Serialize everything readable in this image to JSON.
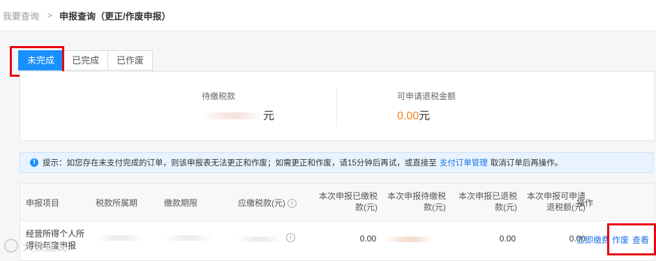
{
  "breadcrumb": {
    "parent": "我要查询",
    "separator": ">",
    "current": "申报查询（更正/作废申报）"
  },
  "tabs": [
    {
      "label": "未完成",
      "active": true
    },
    {
      "label": "已完成",
      "active": false
    },
    {
      "label": "已作废",
      "active": false
    }
  ],
  "summary": {
    "pending_label": "待缴税款",
    "pending_unit": "元",
    "refund_label": "可申请退税金额",
    "refund_value": "0.00",
    "refund_unit": "元"
  },
  "notice": {
    "icon": "info-icon",
    "text_before": "提示：如您存在未支付完成的订单，则该申报表无法更正和作废；如需更正和作废，请15分钟后再试，或直接至",
    "link": "支付订单管理",
    "text_after": "取消订单后再操作。"
  },
  "table": {
    "headers": {
      "item": "申报项目",
      "period": "税款所属期",
      "deadline": "缴款期限",
      "tax_payable": "应缴税款(元)",
      "paid_l1": "本次申报已缴税",
      "paid_l2": "款(元)",
      "pending_l1": "本次申报待缴税",
      "pending_l2": "款(元)",
      "refunded_l1": "本次申报已退税",
      "refunded_l2": "款(元)",
      "refundable_l1": "本次申报可申请",
      "refundable_l2": "退税额(元)",
      "ops": "操作"
    },
    "rows": [
      {
        "item_l1": "经营所得个人所",
        "item_l2": "得税年度申报",
        "paid": "0.00",
        "refunded": "0.00",
        "refundable": "0.00",
        "actions": {
          "pay": "立即缴费",
          "void": "作废",
          "view": "查看"
        }
      }
    ]
  },
  "watermark": "大数据说",
  "colors": {
    "primary": "#1890ff",
    "highlight_box": "#e60012",
    "refund_amount": "#f5801f",
    "link": "#1a73e8"
  }
}
